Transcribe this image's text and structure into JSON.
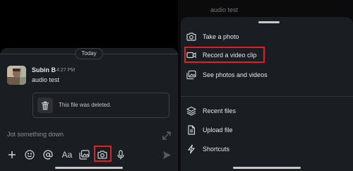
{
  "left_panel": {
    "day_divider": "Today",
    "message": {
      "author": "Subin B",
      "time": "4:27 PM",
      "text": "audio test",
      "file_notice": "This file was deleted."
    },
    "composer": {
      "placeholder": "Jot something down",
      "toolbar": {
        "items": [
          "plus-icon",
          "emoji-icon",
          "mention-icon",
          "text-format-icon",
          "gallery-icon",
          "camera-icon",
          "microphone-icon",
          "send-icon"
        ]
      }
    },
    "highlight_color": "#e01e26"
  },
  "right_panel": {
    "background_text": "audio test",
    "sheet": {
      "items": [
        {
          "label": "Take a photo",
          "icon": "camera-icon"
        },
        {
          "label": "Record a video clip",
          "icon": "video-camera-icon"
        },
        {
          "label": "See photos and videos",
          "icon": "gallery-icon"
        },
        {
          "label": "Recent files",
          "icon": "layers-icon"
        },
        {
          "label": "Upload file",
          "icon": "file-icon"
        },
        {
          "label": "Shortcuts",
          "icon": "lightning-icon"
        }
      ]
    }
  }
}
